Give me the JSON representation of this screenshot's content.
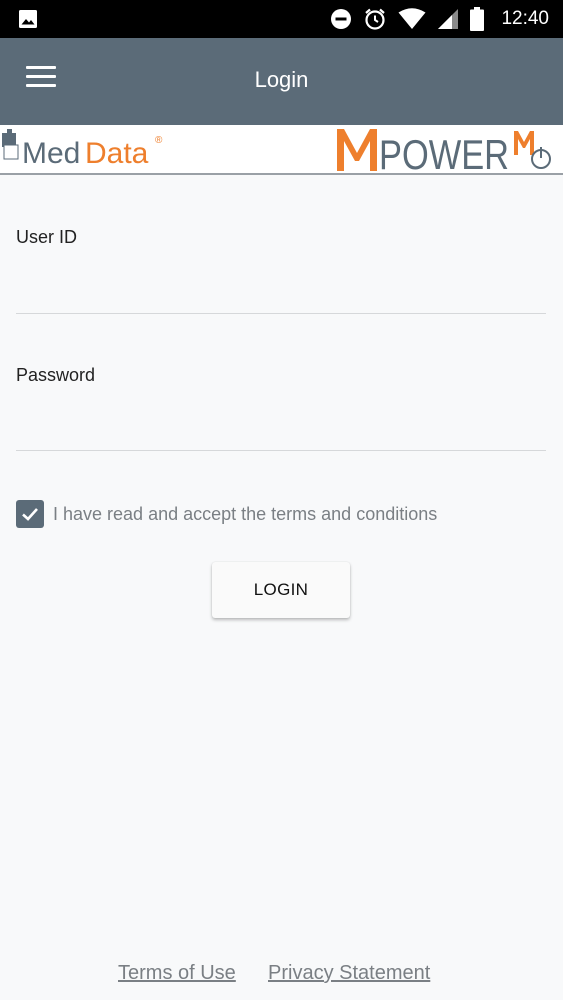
{
  "status_bar": {
    "time": "12:40",
    "icons": [
      "gallery-icon",
      "do-not-disturb-icon",
      "alarm-icon",
      "wifi-icon",
      "signal-icon",
      "battery-icon"
    ]
  },
  "app_bar": {
    "title": "Login",
    "menu_icon": "hamburger-menu-icon",
    "color": "#5b6b78"
  },
  "logos": {
    "left": "MedData",
    "right": "MPOWER",
    "accent": "#ee7f2d"
  },
  "form": {
    "user_id_label": "User ID",
    "user_id_value": "",
    "password_label": "Password",
    "password_value": "",
    "terms_checked": true,
    "terms_text": "I have read and accept the terms and conditions",
    "login_label": "LOGIN"
  },
  "footer": {
    "terms_link": "Terms of Use",
    "privacy_link": "Privacy Statement"
  }
}
